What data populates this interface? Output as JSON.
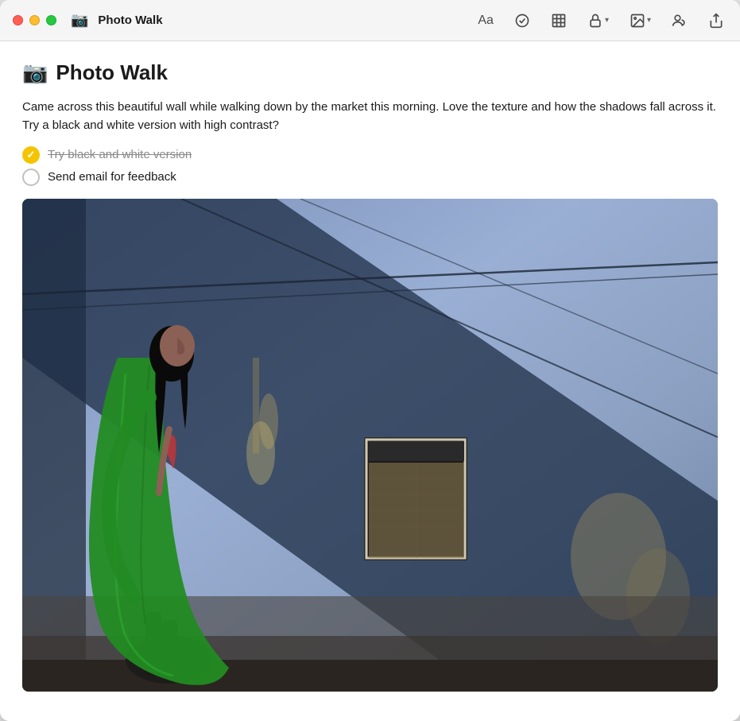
{
  "window": {
    "title": "Photo Walk",
    "icon": "📷"
  },
  "titlebar": {
    "traffic_lights": {
      "close_color": "#ff5f57",
      "minimize_color": "#febc2e",
      "maximize_color": "#28c840"
    },
    "app_icon": "📷",
    "title": "Photo Walk",
    "actions": {
      "font_label": "Aa",
      "check_label": "⊙",
      "table_label": "⊞",
      "lock_label": "lock",
      "image_label": "image",
      "collab_label": "collab",
      "share_label": "share"
    }
  },
  "note": {
    "title_icon": "📷",
    "title": "Photo Walk",
    "body": "Came across this beautiful wall while walking down by the market this morning. Love the texture and how the shadows fall across it. Try a black and white version with high contrast?",
    "checklist": [
      {
        "id": "item1",
        "label": "Try black and white version",
        "done": true
      },
      {
        "id": "item2",
        "label": "Send email for feedback",
        "done": false
      }
    ]
  },
  "colors": {
    "accent": "#f5c400",
    "wall_blue": "#7a8fbb",
    "shadow_dark": "#2a3045",
    "ground": "#3a3530"
  }
}
